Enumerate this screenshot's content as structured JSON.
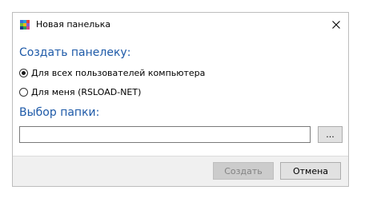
{
  "window": {
    "title": "Новая панелька"
  },
  "section_create": {
    "heading": "Создать панелеку:"
  },
  "options": [
    {
      "label": "Для всех пользователей компьютера",
      "selected": true
    },
    {
      "label": "Для меня (RSLOAD-NET)",
      "selected": false
    }
  ],
  "section_folder": {
    "heading": "Выбор папки:"
  },
  "folder_input": {
    "value": "",
    "placeholder": ""
  },
  "buttons": {
    "browse": "...",
    "create": "Создать",
    "cancel": "Отмена"
  },
  "icons": {
    "app": "app-grid-icon",
    "close": "close-icon"
  },
  "colors": {
    "heading": "#1e5aa8",
    "footer_bg": "#f0f0f0",
    "disabled_text": "#838383"
  }
}
